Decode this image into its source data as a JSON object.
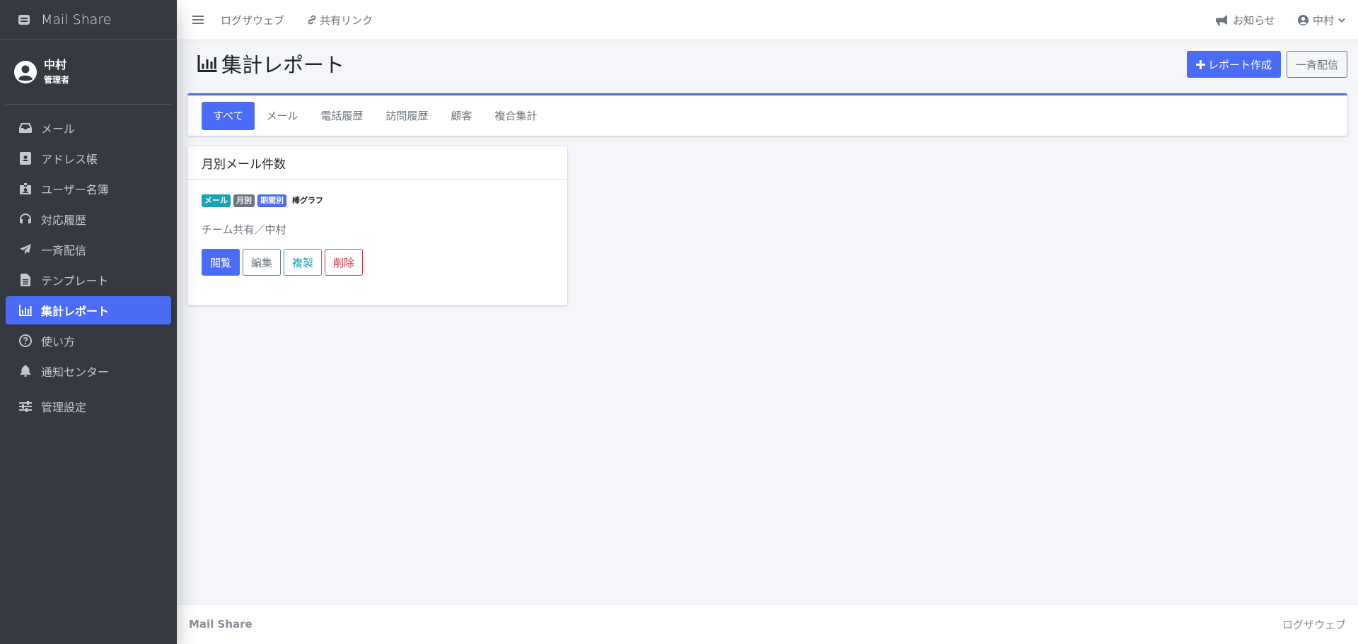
{
  "brand": {
    "name": "Mail Share",
    "icon": "mail-box-icon"
  },
  "user": {
    "name": "中村",
    "role": "管理者"
  },
  "sidebar": {
    "items": [
      {
        "label": "メール",
        "icon": "inbox-icon"
      },
      {
        "label": "アドレス帳",
        "icon": "address-book-icon"
      },
      {
        "label": "ユーザー名簿",
        "icon": "id-badge-icon"
      },
      {
        "label": "対応履歴",
        "icon": "headset-icon"
      },
      {
        "label": "一斉配信",
        "icon": "paper-plane-icon"
      },
      {
        "label": "テンプレート",
        "icon": "file-icon"
      },
      {
        "label": "集計レポート",
        "icon": "chart-bar-icon",
        "active": true
      },
      {
        "label": "使い方",
        "icon": "question-circle-icon"
      },
      {
        "label": "通知センター",
        "icon": "bell-icon"
      },
      {
        "label": "管理設定",
        "icon": "sliders-icon"
      }
    ]
  },
  "topbar": {
    "link1": "ログザウェブ",
    "link2": "共有リンク",
    "notice": "お知らせ",
    "user": "中村"
  },
  "page": {
    "title": "集計レポート",
    "create_button": "レポート作成",
    "broadcast_button": "一斉配信"
  },
  "tabs": [
    "すべて",
    "メール",
    "電話履歴",
    "訪問履歴",
    "顧客",
    "複合集計"
  ],
  "report": {
    "title": "月別メール件数",
    "badges": [
      "メール",
      "月別",
      "期間別",
      "棒グラフ"
    ],
    "owner": "チーム共有／中村",
    "view": "閲覧",
    "edit": "編集",
    "copy": "複製",
    "delete": "削除"
  },
  "footer": {
    "left": "Mail Share",
    "right": "ログザウェブ"
  },
  "colors": {
    "accent": "#4a6cf7",
    "sidebar": "#343a40",
    "info": "#17a2b8",
    "danger": "#dc3545"
  }
}
